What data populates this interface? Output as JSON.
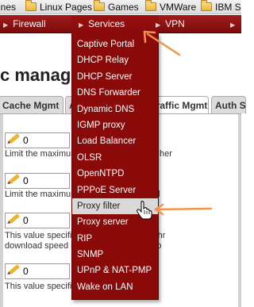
{
  "bookmarks": [
    {
      "label": "ines"
    },
    {
      "label": "Linux Pages"
    },
    {
      "label": "Games"
    },
    {
      "label": "VMWare"
    },
    {
      "label": "IBM S"
    }
  ],
  "nav": {
    "firewall": "Firewall",
    "services": "Services",
    "vpn": "VPN"
  },
  "page": {
    "title": "c manager",
    "tabs": [
      "Cache Mgmt",
      "A",
      "Traffic Mgmt",
      "Auth S"
    ],
    "fields": [
      {
        "value": "0",
        "desc": "Limit the maximum                            to the size specified her"
      },
      {
        "value": "0",
        "desc": "Limit the maximum                            size specified here (l"
      },
      {
        "value": "0",
        "desc": "This value specifi                      cond) the bandwidth thr",
        "desc2": "download speed in                     this value. Set to 0 to"
      },
      {
        "value": "0",
        "desc": "This value specifi                         ng per host. Set to 0 t"
      }
    ]
  },
  "services_menu": {
    "items": [
      "Captive Portal",
      "DHCP Relay",
      "DHCP Server",
      "DNS Forwarder",
      "Dynamic DNS",
      "IGMP proxy",
      "Load Balancer",
      "OLSR",
      "OpenNTPD",
      "PPPoE Server",
      "Proxy filter",
      "Proxy server",
      "RIP",
      "SNMP",
      "UPnP & NAT-PMP",
      "Wake on LAN"
    ],
    "hovered": "Proxy filter"
  },
  "colors": {
    "nav_bg": "#8f1010",
    "menu_bg": "#8a0a0a",
    "hover_bg": "#d9d9d9",
    "annotation_arrow": "#f0954a"
  },
  "icons": {
    "folder": "folder-icon",
    "pencil": "pencil-icon",
    "cursor": "hand-cursor-icon",
    "arrow": "annotation-arrow"
  }
}
